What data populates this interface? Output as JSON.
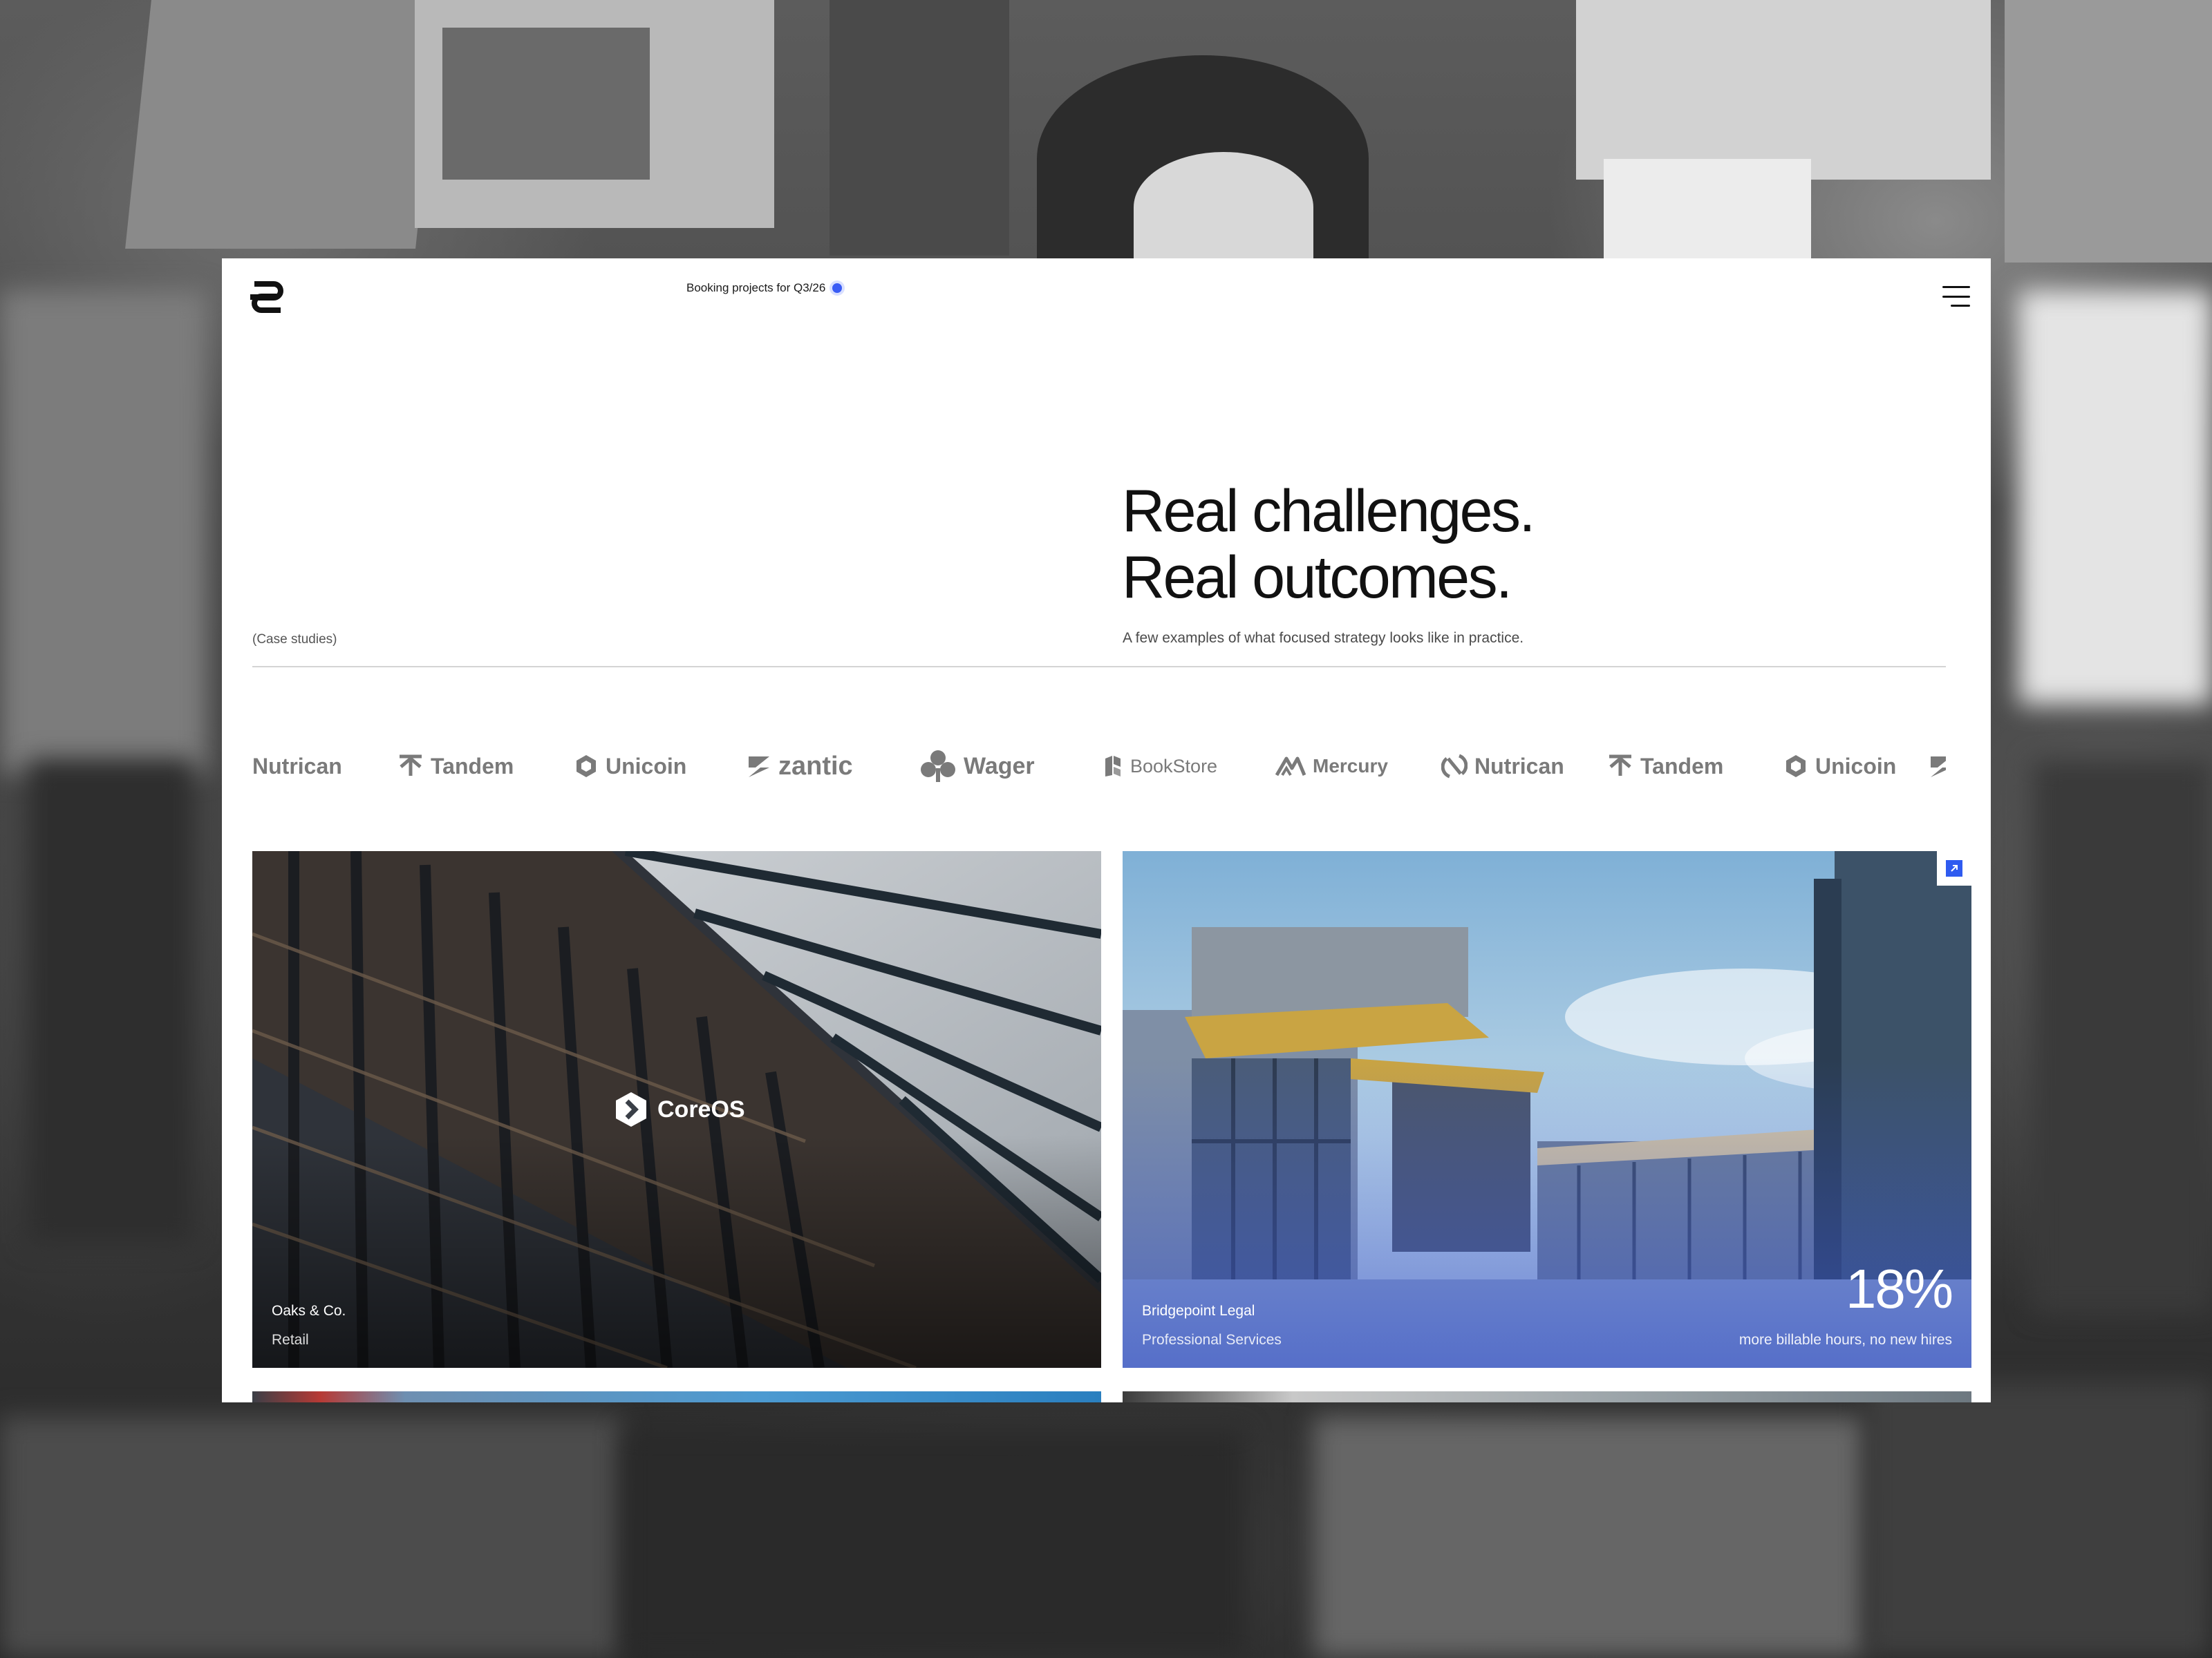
{
  "header": {
    "booking_text": "Booking projects for Q3/26",
    "logo_icon": "studio-logo-icon",
    "menu_icon": "hamburger-menu-icon"
  },
  "hero": {
    "title_line_1": "Real challenges.",
    "title_line_2": "Real outcomes.",
    "subtitle": "A few examples of what focused strategy looks like in practice.",
    "section_label": "(Case studies)"
  },
  "clients": [
    {
      "name": "Nutrican",
      "icon": "none"
    },
    {
      "name": "Tandem",
      "icon": "tandem-logo-icon"
    },
    {
      "name": "Unicoin",
      "icon": "unicoin-logo-icon"
    },
    {
      "name": "zantic",
      "icon": "zantic-logo-icon"
    },
    {
      "name": "Wager",
      "icon": "wager-logo-icon"
    },
    {
      "name": "BookStore",
      "icon": "bookstore-logo-icon"
    },
    {
      "name": "Mercury",
      "icon": "mercury-logo-icon"
    },
    {
      "name": "Nutrican",
      "icon": "nutrican-logo-icon"
    },
    {
      "name": "Tandem",
      "icon": "tandem-logo-icon"
    },
    {
      "name": "Unicoin",
      "icon": "unicoin-logo-icon"
    }
  ],
  "cards": [
    {
      "client": "Oaks & Co.",
      "sector": "Retail",
      "brand": "CoreOS",
      "brand_icon": "coreos-logo-icon"
    },
    {
      "client": "Bridgepoint Legal",
      "sector": "Professional Services",
      "stat": "18%",
      "stat_label": "more billable hours, no new hires",
      "link_icon": "arrow-up-right-icon"
    }
  ],
  "colors": {
    "accent": "#2f5bf0",
    "text": "#111111",
    "muted_logo": "#7a7a7a"
  }
}
